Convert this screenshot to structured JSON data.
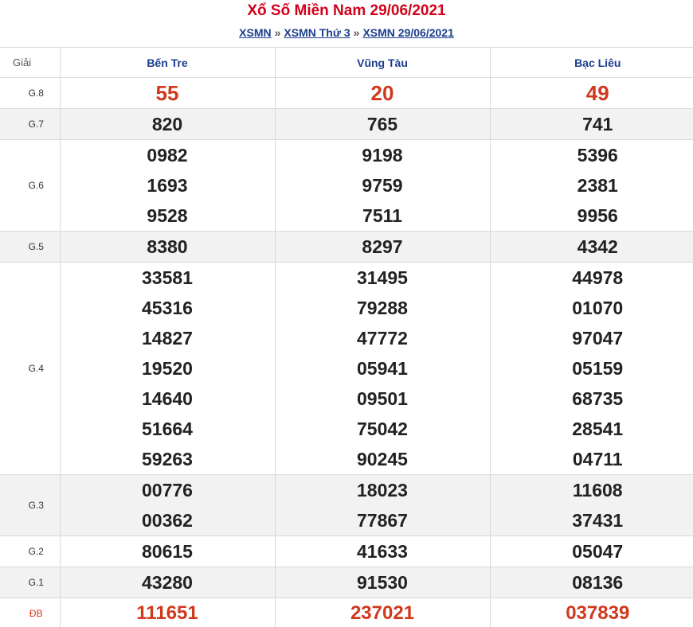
{
  "header": {
    "title": "Xổ Số Miền Nam 29/06/2021",
    "breadcrumb": [
      "XSMN",
      "XSMN Thứ 3",
      "XSMN 29/06/2021"
    ],
    "separator": "»"
  },
  "table": {
    "label_header": "Giải",
    "provinces": [
      "Bến Tre",
      "Vũng Tàu",
      "Bạc Liêu"
    ],
    "prizes": [
      {
        "label": "G.8",
        "results": [
          [
            "55"
          ],
          [
            "20"
          ],
          [
            "49"
          ]
        ]
      },
      {
        "label": "G.7",
        "results": [
          [
            "820"
          ],
          [
            "765"
          ],
          [
            "741"
          ]
        ]
      },
      {
        "label": "G.6",
        "results": [
          [
            "0982",
            "1693",
            "9528"
          ],
          [
            "9198",
            "9759",
            "7511"
          ],
          [
            "5396",
            "2381",
            "9956"
          ]
        ]
      },
      {
        "label": "G.5",
        "results": [
          [
            "8380"
          ],
          [
            "8297"
          ],
          [
            "4342"
          ]
        ]
      },
      {
        "label": "G.4",
        "results": [
          [
            "33581",
            "45316",
            "14827",
            "19520",
            "14640",
            "51664",
            "59263"
          ],
          [
            "31495",
            "79288",
            "47772",
            "05941",
            "09501",
            "75042",
            "90245"
          ],
          [
            "44978",
            "01070",
            "97047",
            "05159",
            "68735",
            "28541",
            "04711"
          ]
        ]
      },
      {
        "label": "G.3",
        "results": [
          [
            "00776",
            "00362"
          ],
          [
            "18023",
            "77867"
          ],
          [
            "11608",
            "37431"
          ]
        ]
      },
      {
        "label": "G.2",
        "results": [
          [
            "80615"
          ],
          [
            "41633"
          ],
          [
            "05047"
          ]
        ]
      },
      {
        "label": "G.1",
        "results": [
          [
            "43280"
          ],
          [
            "91530"
          ],
          [
            "08136"
          ]
        ]
      },
      {
        "label": "ĐB",
        "results": [
          [
            "111651"
          ],
          [
            "237021"
          ],
          [
            "037839"
          ]
        ]
      }
    ]
  },
  "colors": {
    "title_red": "#d0021b",
    "link_blue": "#1a3e8c",
    "highlight_red": "#d0391e",
    "row_shade": "#f2f2f2"
  }
}
